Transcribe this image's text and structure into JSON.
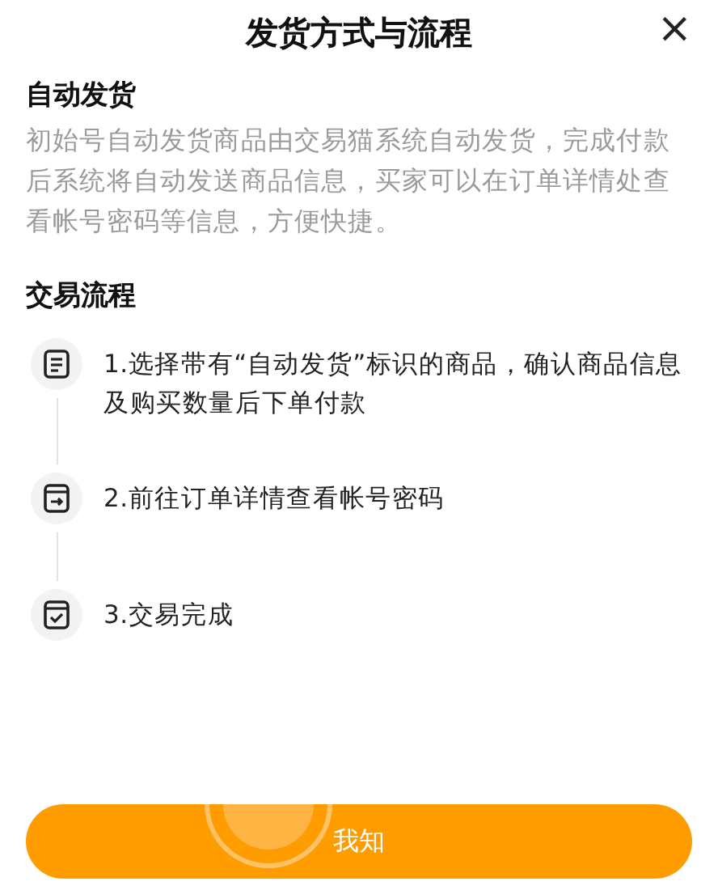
{
  "title": "发货方式与流程",
  "close": "×",
  "auto_delivery": {
    "heading": "自动发货",
    "text": "初始号自动发货商品由交易猫系统自动发货，完成付款后系统将自动发送商品信息，买家可以在订单详情处查看帐号密码等信息，方便快捷。"
  },
  "process": {
    "heading": "交易流程",
    "steps": [
      {
        "text": "1.选择带有“自动发货”标识的商品，确认商品信息及购买数量后下单付款"
      },
      {
        "text": "2.前往订单详情查看帐号密码"
      },
      {
        "text": "3.交易完成"
      }
    ]
  },
  "button": "我知"
}
